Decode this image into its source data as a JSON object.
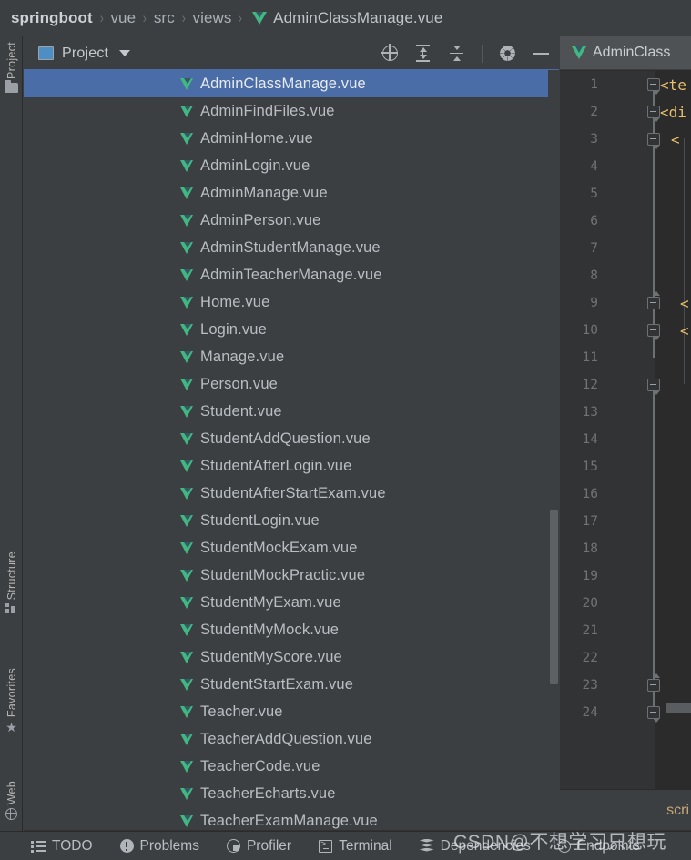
{
  "breadcrumb": {
    "separator": "›",
    "items": [
      {
        "label": "springboot",
        "type": "root"
      },
      {
        "label": "vue",
        "type": "dir"
      },
      {
        "label": "src",
        "type": "dir"
      },
      {
        "label": "views",
        "type": "dir"
      },
      {
        "label": "AdminClassManage.vue",
        "type": "file",
        "icon": "vue-file-icon"
      }
    ]
  },
  "toolstrip": {
    "top": [
      {
        "label": "Project",
        "icon": "folder-icon",
        "active": true
      }
    ],
    "bottom": [
      {
        "label": "Structure",
        "icon": "structure-icon"
      },
      {
        "label": "Favorites",
        "icon": "star-icon"
      },
      {
        "label": "Web",
        "icon": "globe-icon"
      }
    ]
  },
  "project_panel": {
    "title": "Project",
    "title_icon": "project-view-icon",
    "dropdown_icon": "chevron-down-icon",
    "actions": [
      {
        "name": "scroll-from-source-icon",
        "tooltip": "Select Opened File"
      },
      {
        "name": "expand-all-icon",
        "tooltip": "Expand All"
      },
      {
        "name": "collapse-all-icon",
        "tooltip": "Collapse All"
      },
      {
        "name": "settings-gear-icon",
        "tooltip": "Options"
      },
      {
        "name": "hide-icon",
        "tooltip": "Hide"
      }
    ],
    "files": [
      {
        "name": "AdminClassManage.vue",
        "selected": true
      },
      {
        "name": "AdminFindFiles.vue",
        "selected": false
      },
      {
        "name": "AdminHome.vue",
        "selected": false
      },
      {
        "name": "AdminLogin.vue",
        "selected": false
      },
      {
        "name": "AdminManage.vue",
        "selected": false
      },
      {
        "name": "AdminPerson.vue",
        "selected": false
      },
      {
        "name": "AdminStudentManage.vue",
        "selected": false
      },
      {
        "name": "AdminTeacherManage.vue",
        "selected": false
      },
      {
        "name": "Home.vue",
        "selected": false
      },
      {
        "name": "Login.vue",
        "selected": false
      },
      {
        "name": "Manage.vue",
        "selected": false
      },
      {
        "name": "Person.vue",
        "selected": false
      },
      {
        "name": "Student.vue",
        "selected": false
      },
      {
        "name": "StudentAddQuestion.vue",
        "selected": false
      },
      {
        "name": "StudentAfterLogin.vue",
        "selected": false
      },
      {
        "name": "StudentAfterStartExam.vue",
        "selected": false
      },
      {
        "name": "StudentLogin.vue",
        "selected": false
      },
      {
        "name": "StudentMockExam.vue",
        "selected": false
      },
      {
        "name": "StudentMockPractic.vue",
        "selected": false
      },
      {
        "name": "StudentMyExam.vue",
        "selected": false
      },
      {
        "name": "StudentMyMock.vue",
        "selected": false
      },
      {
        "name": "StudentMyScore.vue",
        "selected": false
      },
      {
        "name": "StudentStartExam.vue",
        "selected": false
      },
      {
        "name": "Teacher.vue",
        "selected": false
      },
      {
        "name": "TeacherAddQuestion.vue",
        "selected": false
      },
      {
        "name": "TeacherCode.vue",
        "selected": false
      },
      {
        "name": "TeacherEcharts.vue",
        "selected": false
      },
      {
        "name": "TeacherExamManage.vue",
        "selected": false
      }
    ]
  },
  "editor": {
    "tab": {
      "label": "AdminClass",
      "icon": "vue-file-icon"
    },
    "lines": [
      {
        "num": "1",
        "text": "<te",
        "fold": "end"
      },
      {
        "num": "2",
        "text": "<di",
        "fold": "end"
      },
      {
        "num": "3",
        "text": "<",
        "fold": "end"
      },
      {
        "num": "4",
        "text": "",
        "fold": ""
      },
      {
        "num": "5",
        "text": "",
        "fold": ""
      },
      {
        "num": "6",
        "text": "",
        "fold": ""
      },
      {
        "num": "7",
        "text": "",
        "fold": ""
      },
      {
        "num": "8",
        "text": "",
        "fold": ""
      },
      {
        "num": "9",
        "text": "<",
        "fold": "start"
      },
      {
        "num": "10",
        "text": "<",
        "fold": "end"
      },
      {
        "num": "11",
        "text": "",
        "fold": ""
      },
      {
        "num": "12",
        "text": "",
        "fold": "end"
      },
      {
        "num": "13",
        "text": "",
        "fold": ""
      },
      {
        "num": "14",
        "text": "",
        "fold": ""
      },
      {
        "num": "15",
        "text": "",
        "fold": ""
      },
      {
        "num": "16",
        "text": "",
        "fold": ""
      },
      {
        "num": "17",
        "text": "",
        "fold": ""
      },
      {
        "num": "18",
        "text": "",
        "fold": ""
      },
      {
        "num": "19",
        "text": "",
        "fold": ""
      },
      {
        "num": "20",
        "text": "",
        "fold": ""
      },
      {
        "num": "21",
        "text": "",
        "fold": ""
      },
      {
        "num": "22",
        "text": "",
        "fold": ""
      },
      {
        "num": "23",
        "text": "",
        "fold": "start"
      },
      {
        "num": "24",
        "text": "",
        "fold": "end"
      }
    ],
    "breadcrumb_text": "scri"
  },
  "statusbar": {
    "items": [
      {
        "label": "TODO",
        "icon": "todo-list-icon"
      },
      {
        "label": "Problems",
        "icon": "problems-warning-icon"
      },
      {
        "label": "Profiler",
        "icon": "profiler-icon"
      },
      {
        "label": "Terminal",
        "icon": "terminal-icon"
      },
      {
        "label": "Dependencies",
        "icon": "layers-icon"
      },
      {
        "label": "Endpoints",
        "icon": "endpoints-icon"
      }
    ]
  },
  "watermark": {
    "text": "CSDN@不想学习只想玩"
  },
  "colors": {
    "selection": "#4A6DA7",
    "panel_bg": "#3C3F41",
    "editor_bg": "#2B2B2B",
    "gutter_bg": "#313335",
    "vue_green": "#41B883",
    "code_tag": "#E8BF6A",
    "text": "#B9BEC3"
  }
}
